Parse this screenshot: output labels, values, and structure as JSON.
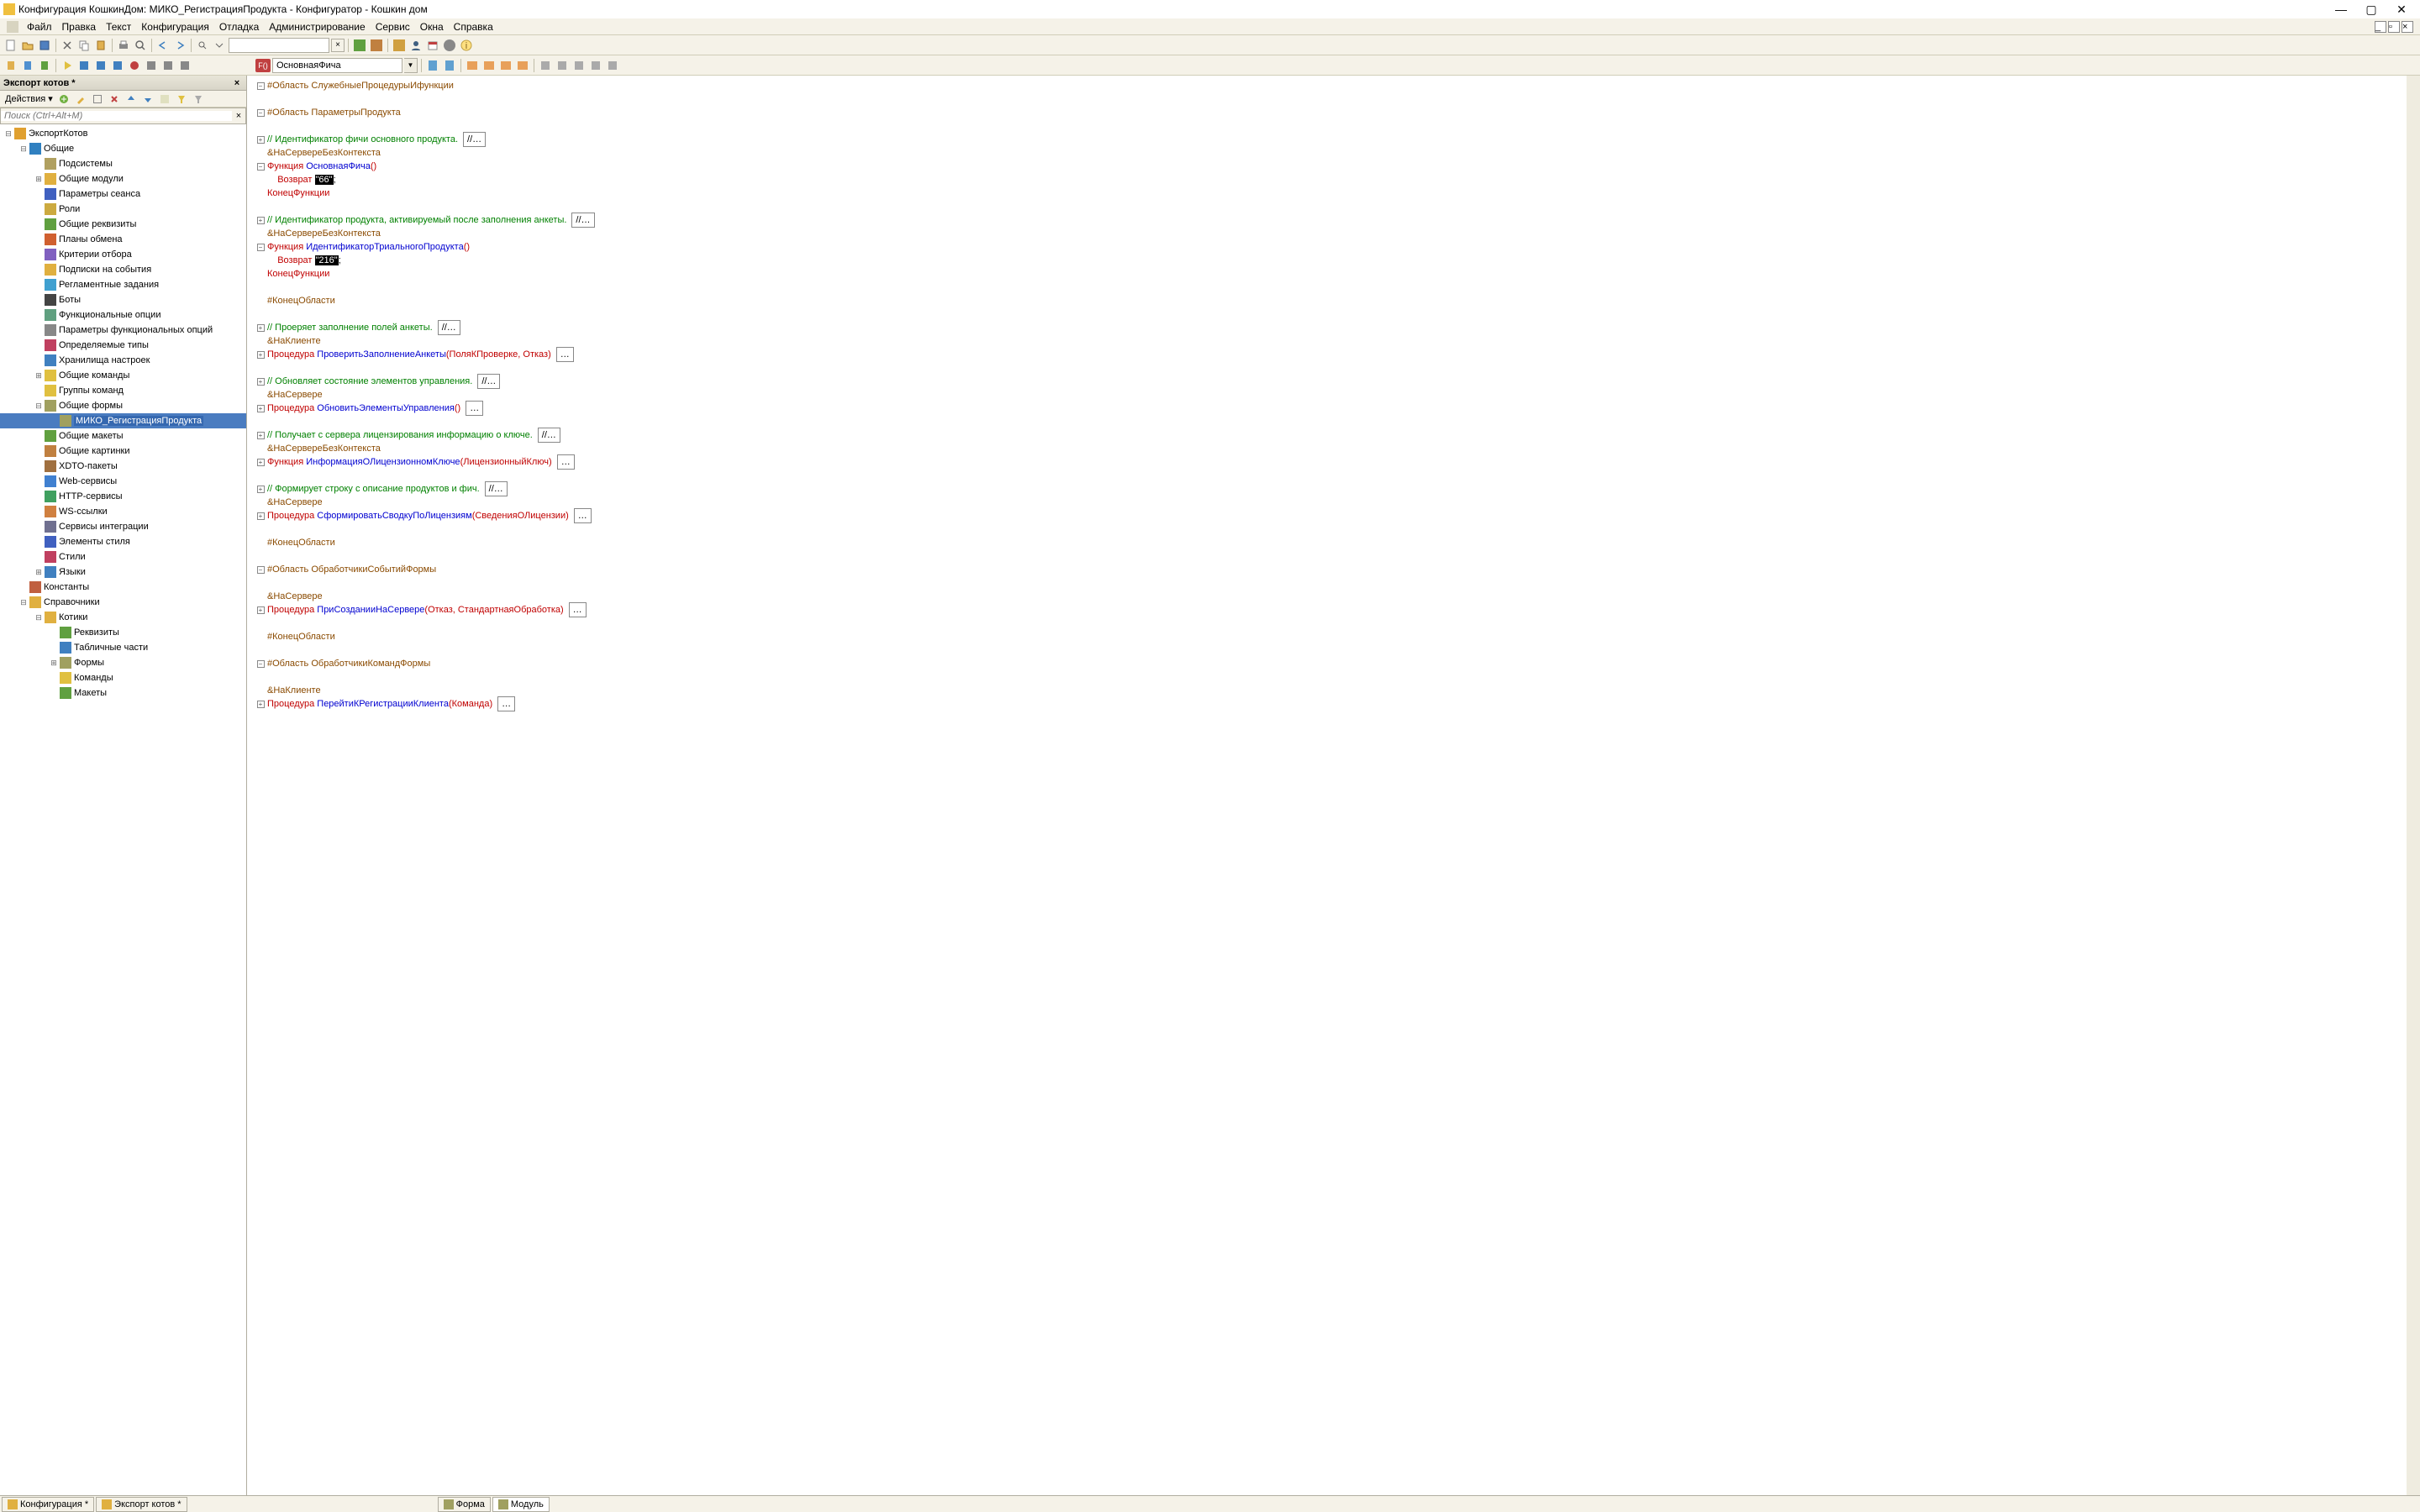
{
  "title": "Конфигурация КошкинДом: МИКО_РегистрацияПродукта - Конфигуратор - Кошкин дом",
  "menu": [
    "Файл",
    "Правка",
    "Текст",
    "Конфигурация",
    "Отладка",
    "Администрирование",
    "Сервис",
    "Окна",
    "Справка"
  ],
  "sidebar": {
    "title": "Экспорт котов *",
    "actions": "Действия",
    "search_ph": "Поиск (Ctrl+Alt+M)"
  },
  "tree": [
    {
      "d": 0,
      "exp": "minus",
      "ico": "#e0a030",
      "label": "ЭкспортКотов"
    },
    {
      "d": 1,
      "exp": "minus",
      "ico": "#3080c0",
      "label": "Общие"
    },
    {
      "d": 2,
      "exp": "none",
      "ico": "#b0a060",
      "label": "Подсистемы"
    },
    {
      "d": 2,
      "exp": "plus",
      "ico": "#e0b040",
      "label": "Общие модули"
    },
    {
      "d": 2,
      "exp": "none",
      "ico": "#4060c0",
      "label": "Параметры сеанса"
    },
    {
      "d": 2,
      "exp": "none",
      "ico": "#ccaa40",
      "label": "Роли"
    },
    {
      "d": 2,
      "exp": "none",
      "ico": "#60a040",
      "label": "Общие реквизиты"
    },
    {
      "d": 2,
      "exp": "none",
      "ico": "#d06030",
      "label": "Планы обмена"
    },
    {
      "d": 2,
      "exp": "none",
      "ico": "#8060c0",
      "label": "Критерии отбора"
    },
    {
      "d": 2,
      "exp": "none",
      "ico": "#e0b040",
      "label": "Подписки на события"
    },
    {
      "d": 2,
      "exp": "none",
      "ico": "#40a0d0",
      "label": "Регламентные задания"
    },
    {
      "d": 2,
      "exp": "none",
      "ico": "#444",
      "label": "Боты"
    },
    {
      "d": 2,
      "exp": "none",
      "ico": "#60a080",
      "label": "Функциональные опции"
    },
    {
      "d": 2,
      "exp": "none",
      "ico": "#888",
      "label": "Параметры функциональных опций"
    },
    {
      "d": 2,
      "exp": "none",
      "ico": "#c04060",
      "label": "Определяемые типы"
    },
    {
      "d": 2,
      "exp": "none",
      "ico": "#4080c0",
      "label": "Хранилища настроек"
    },
    {
      "d": 2,
      "exp": "plus",
      "ico": "#e0c040",
      "label": "Общие команды"
    },
    {
      "d": 2,
      "exp": "none",
      "ico": "#e0c040",
      "label": "Группы команд"
    },
    {
      "d": 2,
      "exp": "minus",
      "ico": "#a0a060",
      "label": "Общие формы"
    },
    {
      "d": 3,
      "exp": "none",
      "ico": "#a0a060",
      "label": "МИКО_РегистрацияПродукта",
      "sel": true
    },
    {
      "d": 2,
      "exp": "none",
      "ico": "#60a040",
      "label": "Общие макеты"
    },
    {
      "d": 2,
      "exp": "none",
      "ico": "#c08040",
      "label": "Общие картинки"
    },
    {
      "d": 2,
      "exp": "none",
      "ico": "#a07040",
      "label": "XDTO-пакеты"
    },
    {
      "d": 2,
      "exp": "none",
      "ico": "#4080d0",
      "label": "Web-сервисы"
    },
    {
      "d": 2,
      "exp": "none",
      "ico": "#40a060",
      "label": "HTTP-сервисы"
    },
    {
      "d": 2,
      "exp": "none",
      "ico": "#d08040",
      "label": "WS-ссылки"
    },
    {
      "d": 2,
      "exp": "none",
      "ico": "#707090",
      "label": "Сервисы интеграции"
    },
    {
      "d": 2,
      "exp": "none",
      "ico": "#4060c0",
      "label": "Элементы стиля"
    },
    {
      "d": 2,
      "exp": "none",
      "ico": "#c04060",
      "label": "Стили"
    },
    {
      "d": 2,
      "exp": "plus",
      "ico": "#4080c0",
      "label": "Языки"
    },
    {
      "d": 1,
      "exp": "none",
      "ico": "#c06040",
      "label": "Константы"
    },
    {
      "d": 1,
      "exp": "minus",
      "ico": "#e0b040",
      "label": "Справочники"
    },
    {
      "d": 2,
      "exp": "minus",
      "ico": "#e0b040",
      "label": "Котики"
    },
    {
      "d": 3,
      "exp": "none",
      "ico": "#60a040",
      "label": "Реквизиты"
    },
    {
      "d": 3,
      "exp": "none",
      "ico": "#4080c0",
      "label": "Табличные части"
    },
    {
      "d": 3,
      "exp": "plus",
      "ico": "#a0a060",
      "label": "Формы"
    },
    {
      "d": 3,
      "exp": "none",
      "ico": "#e0c040",
      "label": "Команды"
    },
    {
      "d": 3,
      "exp": "none",
      "ico": "#60a040",
      "label": "Макеты"
    }
  ],
  "fnCombo": "ОсновнаяФича",
  "code": [
    {
      "f": "minus",
      "segs": [
        {
          "t": "#Область СлужебныеПроцедурыИфункции",
          "c": "kw-brown"
        }
      ]
    },
    {
      "segs": []
    },
    {
      "f": "minus",
      "segs": [
        {
          "t": "#Область ПараметрыПродукта",
          "c": "kw-brown"
        }
      ]
    },
    {
      "segs": []
    },
    {
      "f": "plus",
      "segs": [
        {
          "t": "// Идентификатор фичи основного продукта.",
          "c": "kw-green"
        }
      ],
      "box": "//…"
    },
    {
      "segs": [
        {
          "t": "&НаСервереБезКонтекста",
          "c": "kw-brown"
        }
      ]
    },
    {
      "f": "minus",
      "segs": [
        {
          "t": "Функция ",
          "c": "kw-red"
        },
        {
          "t": "ОсновнаяФича",
          "c": "kw-blue"
        },
        {
          "t": "()",
          "c": "kw-red"
        }
      ]
    },
    {
      "segs": [
        {
          "t": "    Возврат ",
          "c": "kw-red"
        },
        {
          "t": "\"66\"",
          "c": "str-h"
        },
        {
          "t": ";",
          "c": ""
        }
      ]
    },
    {
      "segs": [
        {
          "t": "КонецФункции",
          "c": "kw-red"
        }
      ]
    },
    {
      "segs": []
    },
    {
      "f": "plus",
      "segs": [
        {
          "t": "// Идентификатор продукта, активируемый после заполнения анкеты.",
          "c": "kw-green"
        }
      ],
      "box": "//…"
    },
    {
      "segs": [
        {
          "t": "&НаСервереБезКонтекста",
          "c": "kw-brown"
        }
      ]
    },
    {
      "f": "minus",
      "segs": [
        {
          "t": "Функция ",
          "c": "kw-red"
        },
        {
          "t": "ИдентификаторТриальногоПродукта",
          "c": "kw-blue"
        },
        {
          "t": "()",
          "c": "kw-red"
        }
      ]
    },
    {
      "segs": [
        {
          "t": "    Возврат ",
          "c": "kw-red"
        },
        {
          "t": "\"216\"",
          "c": "str-h"
        },
        {
          "t": ";",
          "c": ""
        }
      ]
    },
    {
      "segs": [
        {
          "t": "КонецФункции",
          "c": "kw-red"
        }
      ]
    },
    {
      "segs": []
    },
    {
      "segs": [
        {
          "t": "#КонецОбласти",
          "c": "kw-brown"
        }
      ]
    },
    {
      "segs": []
    },
    {
      "f": "plus",
      "segs": [
        {
          "t": "// Проеряет заполнение полей анкеты.",
          "c": "kw-green"
        }
      ],
      "box": "//…"
    },
    {
      "segs": [
        {
          "t": "&НаКлиенте",
          "c": "kw-brown"
        }
      ]
    },
    {
      "f": "plus",
      "segs": [
        {
          "t": "Процедура ",
          "c": "kw-red"
        },
        {
          "t": "ПроверитьЗаполнениеАнкеты",
          "c": "kw-blue"
        },
        {
          "t": "(ПоляКПроверке, Отказ)",
          "c": "kw-red"
        }
      ],
      "box": "…"
    },
    {
      "segs": []
    },
    {
      "f": "plus",
      "segs": [
        {
          "t": "// Обновляет состояние элементов управления.",
          "c": "kw-green"
        }
      ],
      "box": "//…"
    },
    {
      "segs": [
        {
          "t": "&НаСервере",
          "c": "kw-brown"
        }
      ]
    },
    {
      "f": "plus",
      "segs": [
        {
          "t": "Процедура ",
          "c": "kw-red"
        },
        {
          "t": "ОбновитьЭлементыУправления",
          "c": "kw-blue"
        },
        {
          "t": "()",
          "c": "kw-red"
        }
      ],
      "box": "…"
    },
    {
      "segs": []
    },
    {
      "f": "plus",
      "segs": [
        {
          "t": "// Получает с сервера лицензирования информацию о ключе.",
          "c": "kw-green"
        }
      ],
      "box": "//…"
    },
    {
      "segs": [
        {
          "t": "&НаСервереБезКонтекста",
          "c": "kw-brown"
        }
      ]
    },
    {
      "f": "plus",
      "segs": [
        {
          "t": "Функция ",
          "c": "kw-red"
        },
        {
          "t": "ИнформацияОЛицензионномКлюче",
          "c": "kw-blue"
        },
        {
          "t": "(ЛицензионныйКлюч)",
          "c": "kw-red"
        }
      ],
      "box": "…"
    },
    {
      "segs": []
    },
    {
      "f": "plus",
      "segs": [
        {
          "t": "// Формирует строку с описание продуктов и фич.",
          "c": "kw-green"
        }
      ],
      "box": "//…"
    },
    {
      "segs": [
        {
          "t": "&НаСервере",
          "c": "kw-brown"
        }
      ]
    },
    {
      "f": "plus",
      "segs": [
        {
          "t": "Процедура ",
          "c": "kw-red"
        },
        {
          "t": "СформироватьСводкуПоЛицензиям",
          "c": "kw-blue"
        },
        {
          "t": "(СведенияОЛицензии)",
          "c": "kw-red"
        }
      ],
      "box": "…"
    },
    {
      "segs": []
    },
    {
      "segs": [
        {
          "t": "#КонецОбласти",
          "c": "kw-brown"
        }
      ]
    },
    {
      "segs": []
    },
    {
      "f": "minus",
      "segs": [
        {
          "t": "#Область ОбработчикиСобытийФормы",
          "c": "kw-brown"
        }
      ]
    },
    {
      "segs": []
    },
    {
      "segs": [
        {
          "t": "&НаСервере",
          "c": "kw-brown"
        }
      ]
    },
    {
      "f": "plus",
      "segs": [
        {
          "t": "Процедура ",
          "c": "kw-red"
        },
        {
          "t": "ПриСозданииНаСервере",
          "c": "kw-blue"
        },
        {
          "t": "(Отказ, СтандартнаяОбработка)",
          "c": "kw-red"
        }
      ],
      "box": "…"
    },
    {
      "segs": []
    },
    {
      "segs": [
        {
          "t": "#КонецОбласти",
          "c": "kw-brown"
        }
      ]
    },
    {
      "segs": []
    },
    {
      "f": "minus",
      "segs": [
        {
          "t": "#Область ОбработчикиКомандФормы",
          "c": "kw-brown"
        }
      ]
    },
    {
      "segs": []
    },
    {
      "segs": [
        {
          "t": "&НаКлиенте",
          "c": "kw-brown"
        }
      ]
    },
    {
      "f": "plus",
      "segs": [
        {
          "t": "Процедура ",
          "c": "kw-red"
        },
        {
          "t": "ПерейтиКРегистрацииКлиента",
          "c": "kw-blue"
        },
        {
          "t": "(Команда)",
          "c": "kw-red"
        }
      ],
      "box": "…"
    }
  ],
  "statusTabs": {
    "left": [
      {
        "ico": "#e0b040",
        "t": "Конфигурация *"
      },
      {
        "ico": "#e0b040",
        "t": "Экспорт котов *"
      }
    ],
    "bottom": [
      {
        "ico": "#a0a060",
        "t": "Форма"
      },
      {
        "ico": "#a0a060",
        "t": "Модуль",
        "active": true
      }
    ]
  }
}
